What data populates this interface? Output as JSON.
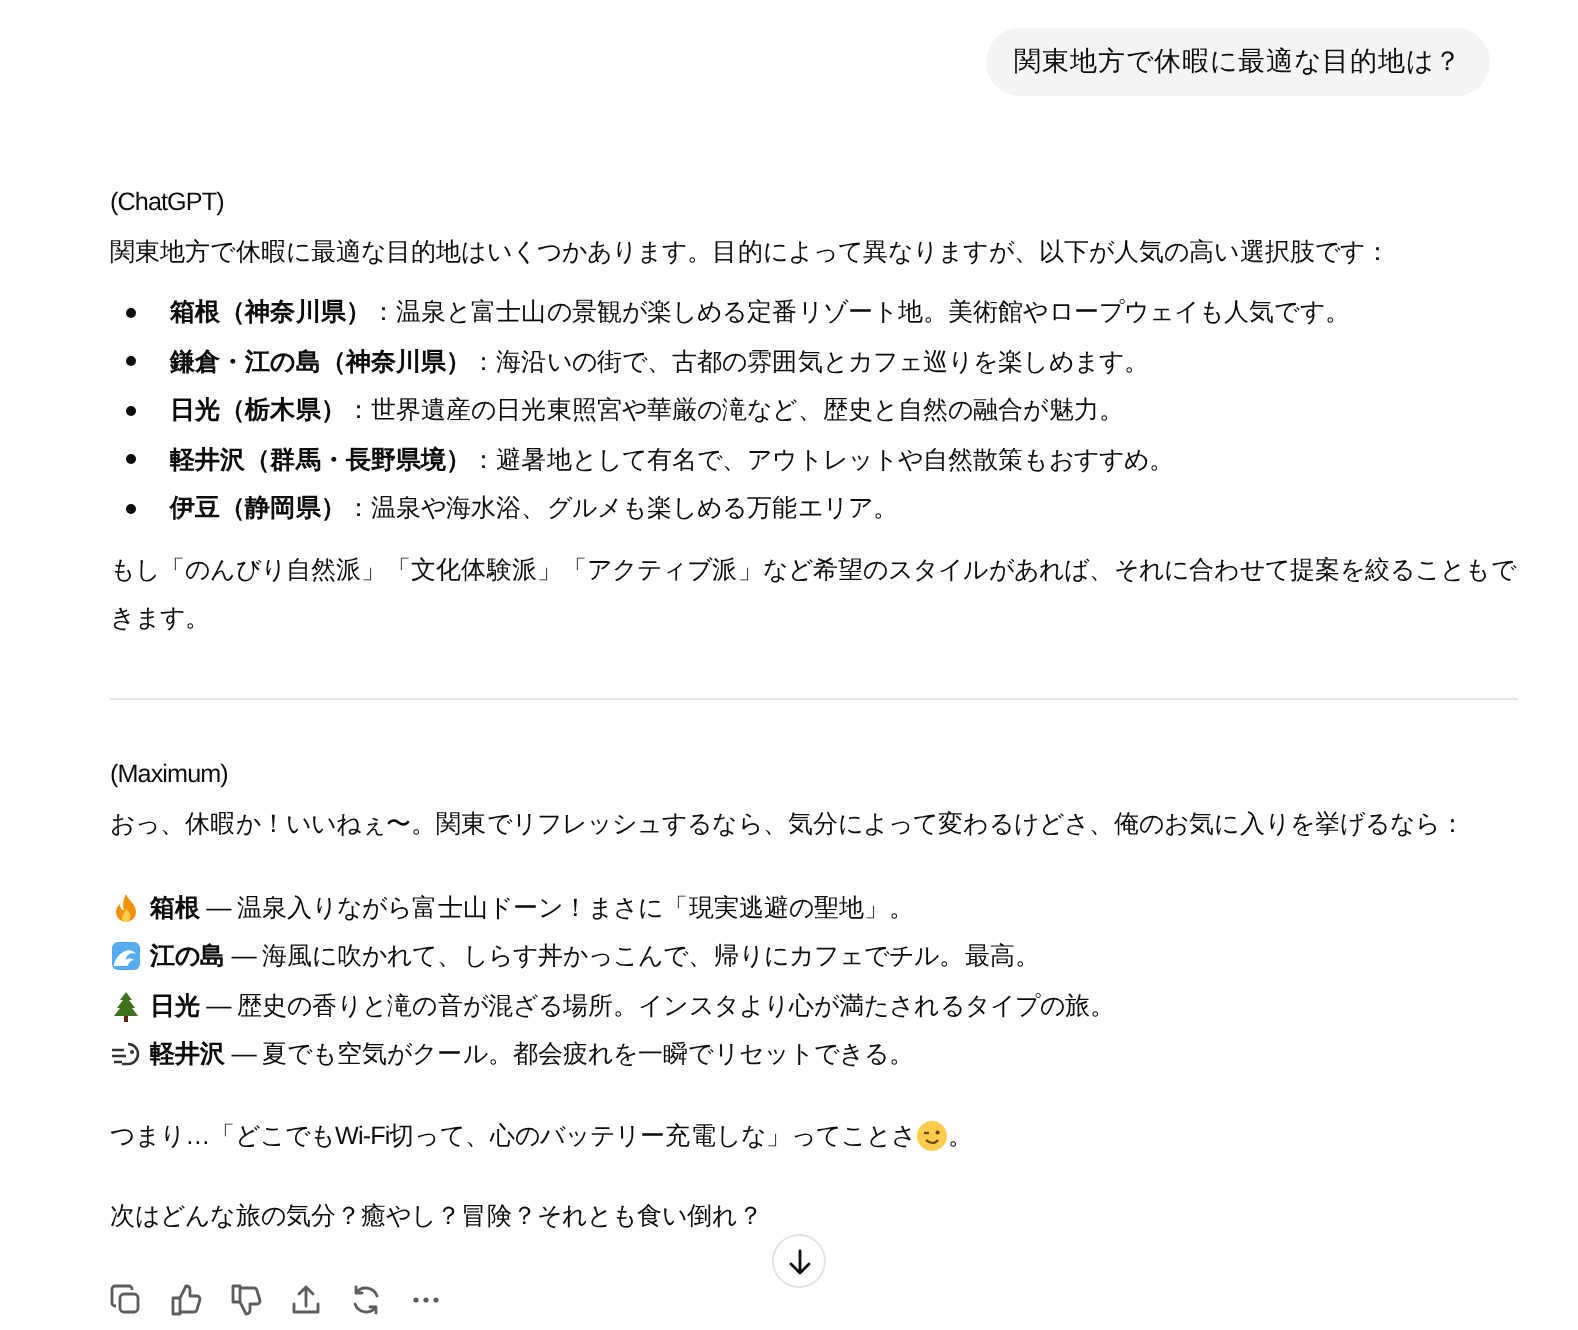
{
  "user_message": "関東地方で休暇に最適な目的地は？",
  "responses": [
    {
      "author": "(ChatGPT)",
      "intro": "関東地方で休暇に最適な目的地はいくつかあります。目的によって異なりますが、以下が人気の高い選択肢です：",
      "bullets": [
        "**箱根（神奈川県）**：温泉と富士山の景観が楽しめる定番リゾート地。美術館やロープウェイも人気です。",
        "**鎌倉・江の島（神奈川県）**：海沿いの街で、古都の雰囲気とカフェ巡りを楽しめます。",
        "**日光（栃木県）**：世界遺産の日光東照宮や華厳の滝など、歴史と自然の融合が魅力。",
        "**軽井沢（群馬・長野県境）**：避暑地として有名で、アウトレットや自然散策もおすすめ。",
        "**伊豆（静岡県）**：温泉や海水浴、グルメも楽しめる万能エリア。"
      ],
      "closing": "もし「のんびり自然派」「文化体験派」「アクティブ派」など希望のスタイルがあれば、それに合わせて提案を絞ることもできます。"
    },
    {
      "author": "(Maximum)",
      "intro": "おっ、休暇か！いいねぇ〜。関東でリフレッシュするなら、気分によって変わるけどさ、俺のお気に入りを挙げるなら：",
      "picks": [
        {
          "kind": "fire",
          "text": "**箱根** — 温泉入りながら富士山ドーン！まさに「現実逃避の聖地」。"
        },
        {
          "kind": "wave",
          "text": "**江の島** — 海風に吹かれて、しらす丼かっこんで、帰りにカフェでチル。最高。"
        },
        {
          "kind": "tree",
          "text": "**日光** — 歴史の香りと滝の音が混ざる場所。インスタより心が満たされるタイプの旅。"
        },
        {
          "kind": "wind",
          "text": "**軽井沢** — 夏でも空気がクール。都会疲れを一瞬でリセットできる。"
        }
      ],
      "summary": {
        "before": "つまり…「どこでもWi-Fi切って、心のバッテリー充電しな」ってことさ",
        "after": "。"
      },
      "question": "次はどんな旅の気分？癒やし？冒険？それとも食い倒れ？"
    }
  ]
}
